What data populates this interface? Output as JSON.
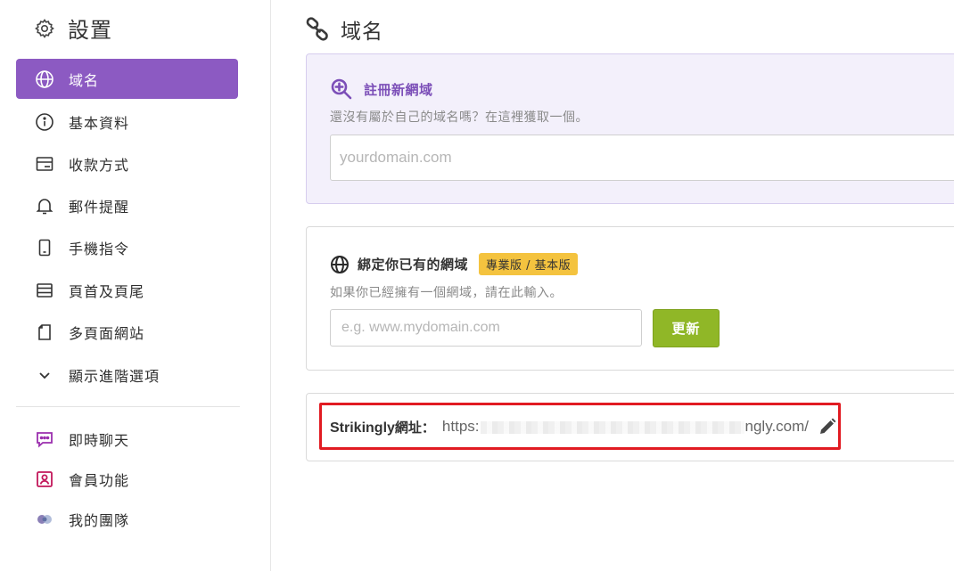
{
  "sidebar": {
    "title": "設置",
    "items": [
      {
        "label": "域名",
        "icon": "globe-icon",
        "active": true
      },
      {
        "label": "基本資料",
        "icon": "info-icon"
      },
      {
        "label": "收款方式",
        "icon": "payment-card-icon"
      },
      {
        "label": "郵件提醒",
        "icon": "bell-icon"
      },
      {
        "label": "手機指令",
        "icon": "mobile-icon"
      },
      {
        "label": "頁首及頁尾",
        "icon": "header-footer-icon"
      },
      {
        "label": "多頁面網站",
        "icon": "pages-icon"
      },
      {
        "label": "顯示進階選項",
        "icon": "chevron-down-icon"
      }
    ],
    "extras": [
      {
        "label": "即時聊天",
        "icon": "chat-icon"
      },
      {
        "label": "會員功能",
        "icon": "member-icon"
      },
      {
        "label": "我的團隊",
        "icon": "team-icon"
      }
    ]
  },
  "main": {
    "title": "域名",
    "register": {
      "heading": "註冊新網域",
      "description": "還沒有屬於自己的域名嗎？在這裡獲取一個。",
      "placeholder": "yourdomain.com",
      "value": ""
    },
    "bind": {
      "heading": "綁定你已有的網域",
      "badge": "專業版 / 基本版",
      "description": "如果你已經擁有一個網域，請在此輸入。",
      "placeholder": "e.g. www.mydomain.com",
      "value": "",
      "button_label": "更新"
    },
    "strikingly_url": {
      "label_prefix": "Strikingly",
      "label_suffix": "網址：",
      "url_start": "https:",
      "url_end": "ngly.com/"
    }
  },
  "colors": {
    "accent": "#8c5ac2",
    "update_button": "#90b727",
    "badge": "#f4c33f",
    "highlight": "#e11b22"
  }
}
